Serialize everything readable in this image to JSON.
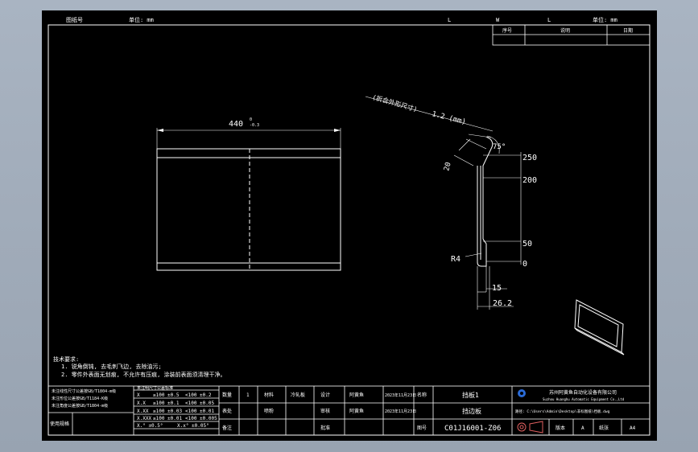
{
  "header": {
    "drawer_label": "图纸号",
    "unit_label": "单位: mm",
    "field_l": "L",
    "field_w": "W",
    "field_t": "L",
    "scale_label": "单位: mm"
  },
  "revision_table": {
    "col1": "序号",
    "col2": "说明",
    "col3": "日期"
  },
  "annotation": {
    "bend_note": "(折合外形尺寸)",
    "thickness": "1.2 (mm)"
  },
  "dimensions": {
    "width": "440",
    "width_tol_top": "0",
    "width_tol_bottom": "-0.3",
    "angle": "75°",
    "flange": "20",
    "h250": "250",
    "h200": "200",
    "h50": "50",
    "h0": "0",
    "radius": "R4",
    "d15": "15",
    "d262": "26.2"
  },
  "notes": {
    "title": "技术要求:",
    "line1": "1. 锐角倒钝, 去毛刺飞边, 去除油污;",
    "line2": "2. 零件外表面无划痕, 不允许有压痕, 涂装前表面须清理干净。"
  },
  "tolerance": {
    "rows_left": [
      "未注线性尺寸公差按GB/T1804-m级",
      "未注形位公差按GB/T1184-K级",
      "未注角度公差按GB/T1804-m级"
    ],
    "cells": [
      [
        "X",
        "≥100 ±0.5",
        "<100 ±0.2"
      ],
      [
        "X.X",
        "≥100 ±0.1",
        "<100 ±0.05"
      ],
      [
        "X.XX",
        "≥100 ±0.03",
        "<100 ±0.01"
      ],
      [
        "X.XXX",
        "≥100 ±0.01",
        "<100 ±0.005"
      ],
      [
        "X.°  ±0.5°",
        "X.x°  ±0.05°",
        ""
      ]
    ],
    "header": "未注明尺寸公差标准",
    "bottom_label": "使用规格"
  },
  "titleblock": {
    "c_qty_label": "数量",
    "c_qty": "1",
    "c_material_label": "材料",
    "c_material": "冷轧板",
    "c_design_label": "设计",
    "c_designer": "阿黄鱼",
    "c_date1": "2023年11月23日",
    "c_name_label": "名称",
    "c_name": "挡板1",
    "r2_label": "表处",
    "r2_val": "喷粉",
    "r2_check": "审核",
    "r2_checker": "阿黄鱼",
    "r2_date": "2023年11月23日",
    "r2_name": "挡边板",
    "r3_label": "备注",
    "r3_approve": "批准",
    "r3_code_label": "图号",
    "drawing_no": "C01J16001-Z06",
    "company_cn": "苏州阿黄鱼自动化设备有限公司",
    "company_en": "Suzhou Huanghu Automatic Equipment Co.,Ltd",
    "path": "路径: C:\\Users\\Admin\\Desktop\\非标图纸\\挡板.dwg",
    "ver_label": "版本",
    "ver": "A",
    "size_label": "纸张",
    "size": "A4"
  }
}
